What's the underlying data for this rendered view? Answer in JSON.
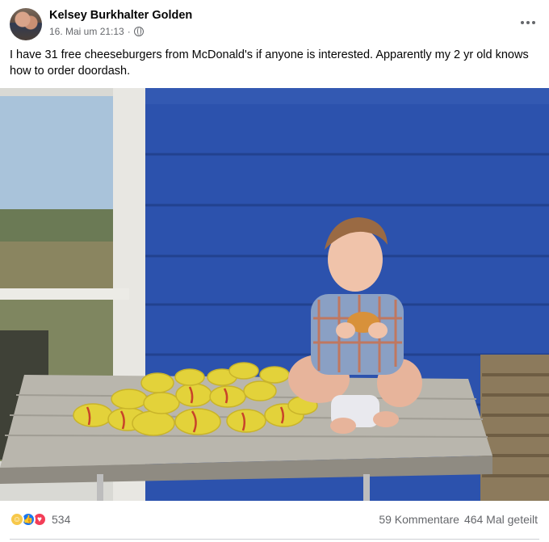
{
  "post": {
    "author": "Kelsey Burkhalter Golden",
    "date": "16. Mai um 21:13",
    "meta_separator": "·",
    "privacy_icon": "globe-icon",
    "more_icon": "more-options-icon",
    "text": "I have 31 free cheeseburgers from McDonald's if anyone is interested. Apparently my 2 yr old knows how to order doordash."
  },
  "photo": {
    "subject": "toddler-with-cheeseburgers-photo"
  },
  "footer": {
    "reaction_icons": [
      "haha-reaction-icon",
      "like-reaction-icon",
      "love-reaction-icon"
    ],
    "reaction_count": "534",
    "comments": "59 Kommentare",
    "shares": "464 Mal geteilt"
  },
  "colors": {
    "secondary_text": "#65676b",
    "like_blue": "#1877f2",
    "love_red": "#f33e58",
    "haha_yellow": "#f7c84a",
    "wall_blue": "#2a4fa8"
  }
}
